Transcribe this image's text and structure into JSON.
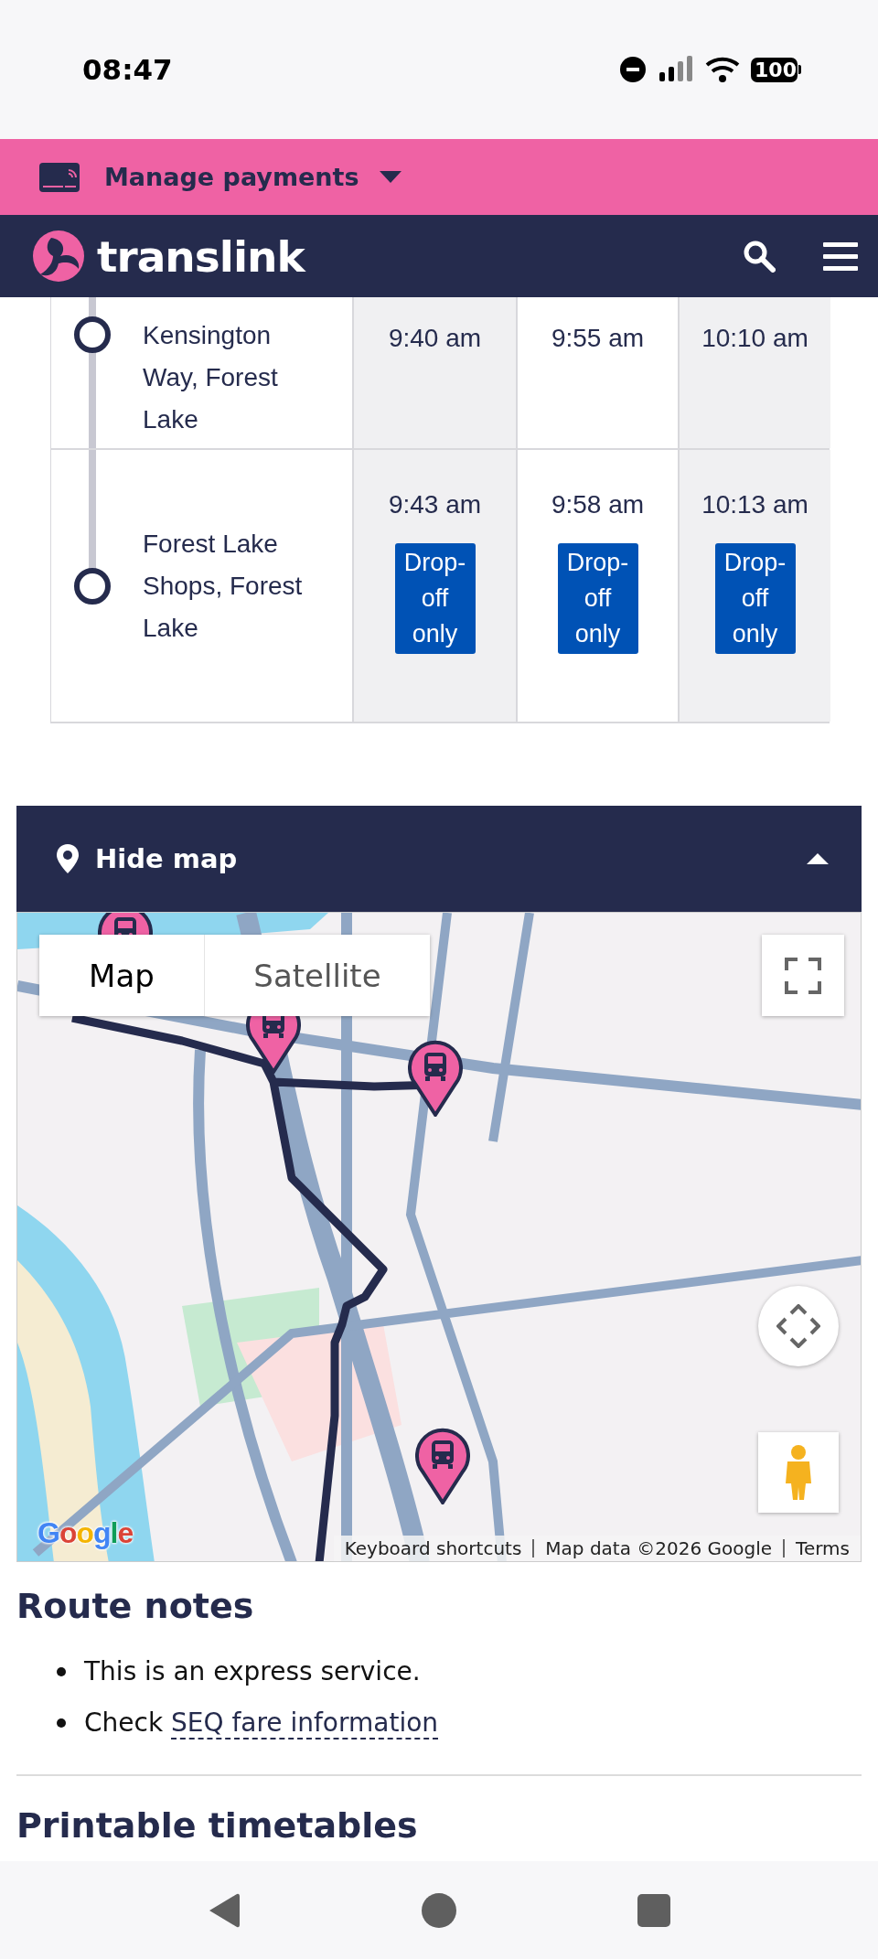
{
  "status_bar": {
    "time": "08:47",
    "battery": "100"
  },
  "payments_bar": {
    "label": "Manage payments"
  },
  "header": {
    "brand": "translink"
  },
  "timetable": {
    "rows": [
      {
        "stop": "Kensington Way, Forest Lake",
        "times": [
          {
            "time": "9:40 am"
          },
          {
            "time": "9:55 am"
          },
          {
            "time": "10:10 am"
          }
        ]
      },
      {
        "stop": "Forest Lake Shops, Forest Lake",
        "times": [
          {
            "time": "9:43 am",
            "badge": "Drop-off only"
          },
          {
            "time": "9:58 am",
            "badge": "Drop-off only"
          },
          {
            "time": "10:13 am",
            "badge": "Drop-off only"
          }
        ]
      }
    ]
  },
  "map_section": {
    "toggle": {
      "label": "Hide map",
      "expanded": true
    },
    "map": {
      "kind": "picture",
      "map_types": [
        {
          "label": "Map",
          "selected": true
        },
        {
          "label": "Satellite",
          "selected": false
        }
      ],
      "logo": "Google",
      "attribution": [
        "Keyboard shortcuts",
        "Map data ©2026 Google",
        "Terms"
      ]
    }
  },
  "route_notes": {
    "heading": "Route notes",
    "items": [
      {
        "text": "This is an express service."
      },
      {
        "text": "Check ",
        "link": "SEQ fare information"
      }
    ]
  },
  "printable": {
    "heading": "Printable timetables"
  }
}
